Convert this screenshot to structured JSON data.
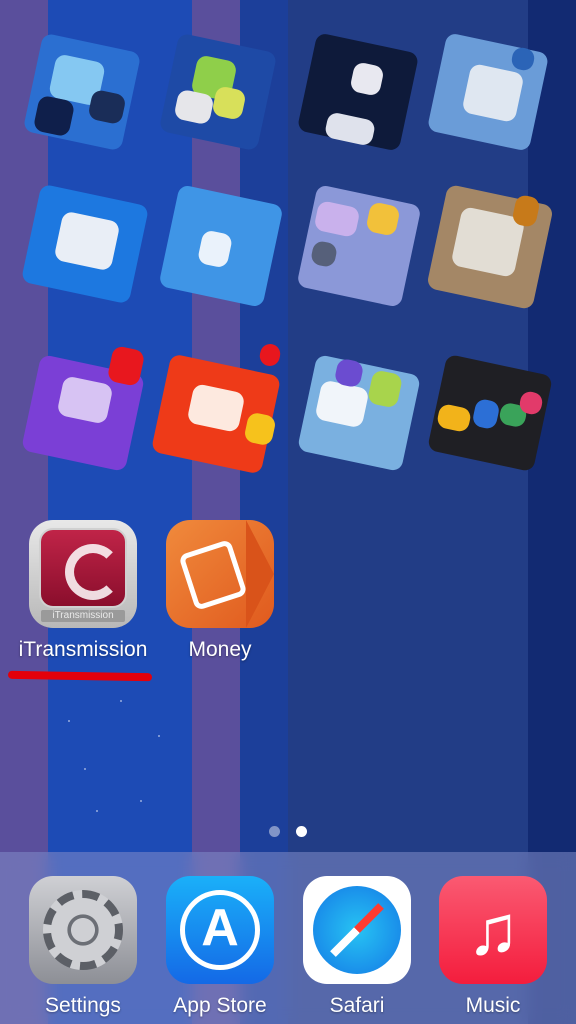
{
  "home_screen": {
    "folders": [
      {
        "name_visible": ""
      },
      {
        "name_visible": ""
      },
      {
        "name_visible": ""
      },
      {
        "name_visible": ""
      },
      {
        "name_visible": ""
      },
      {
        "name_visible": ""
      },
      {
        "name_visible": ""
      },
      {
        "name_visible": ""
      },
      {
        "name_visible": ""
      },
      {
        "name_visible": ""
      },
      {
        "name_visible": ""
      },
      {
        "name_visible": ""
      }
    ],
    "apps": [
      {
        "label": "iTransmission",
        "icon": "itransmission-icon",
        "icon_text": "iTransmission"
      },
      {
        "label": "Money",
        "icon": "money-icon"
      }
    ],
    "page_indicator": {
      "pages": 2,
      "current": 2
    }
  },
  "dock": {
    "apps": [
      {
        "label": "Settings",
        "icon": "settings-icon"
      },
      {
        "label": "App Store",
        "icon": "app-store-icon",
        "glyph": "A"
      },
      {
        "label": "Safari",
        "icon": "safari-icon"
      },
      {
        "label": "Music",
        "icon": "music-icon",
        "glyph": "♫"
      }
    ]
  },
  "annotation": {
    "color": "#e3000b"
  }
}
